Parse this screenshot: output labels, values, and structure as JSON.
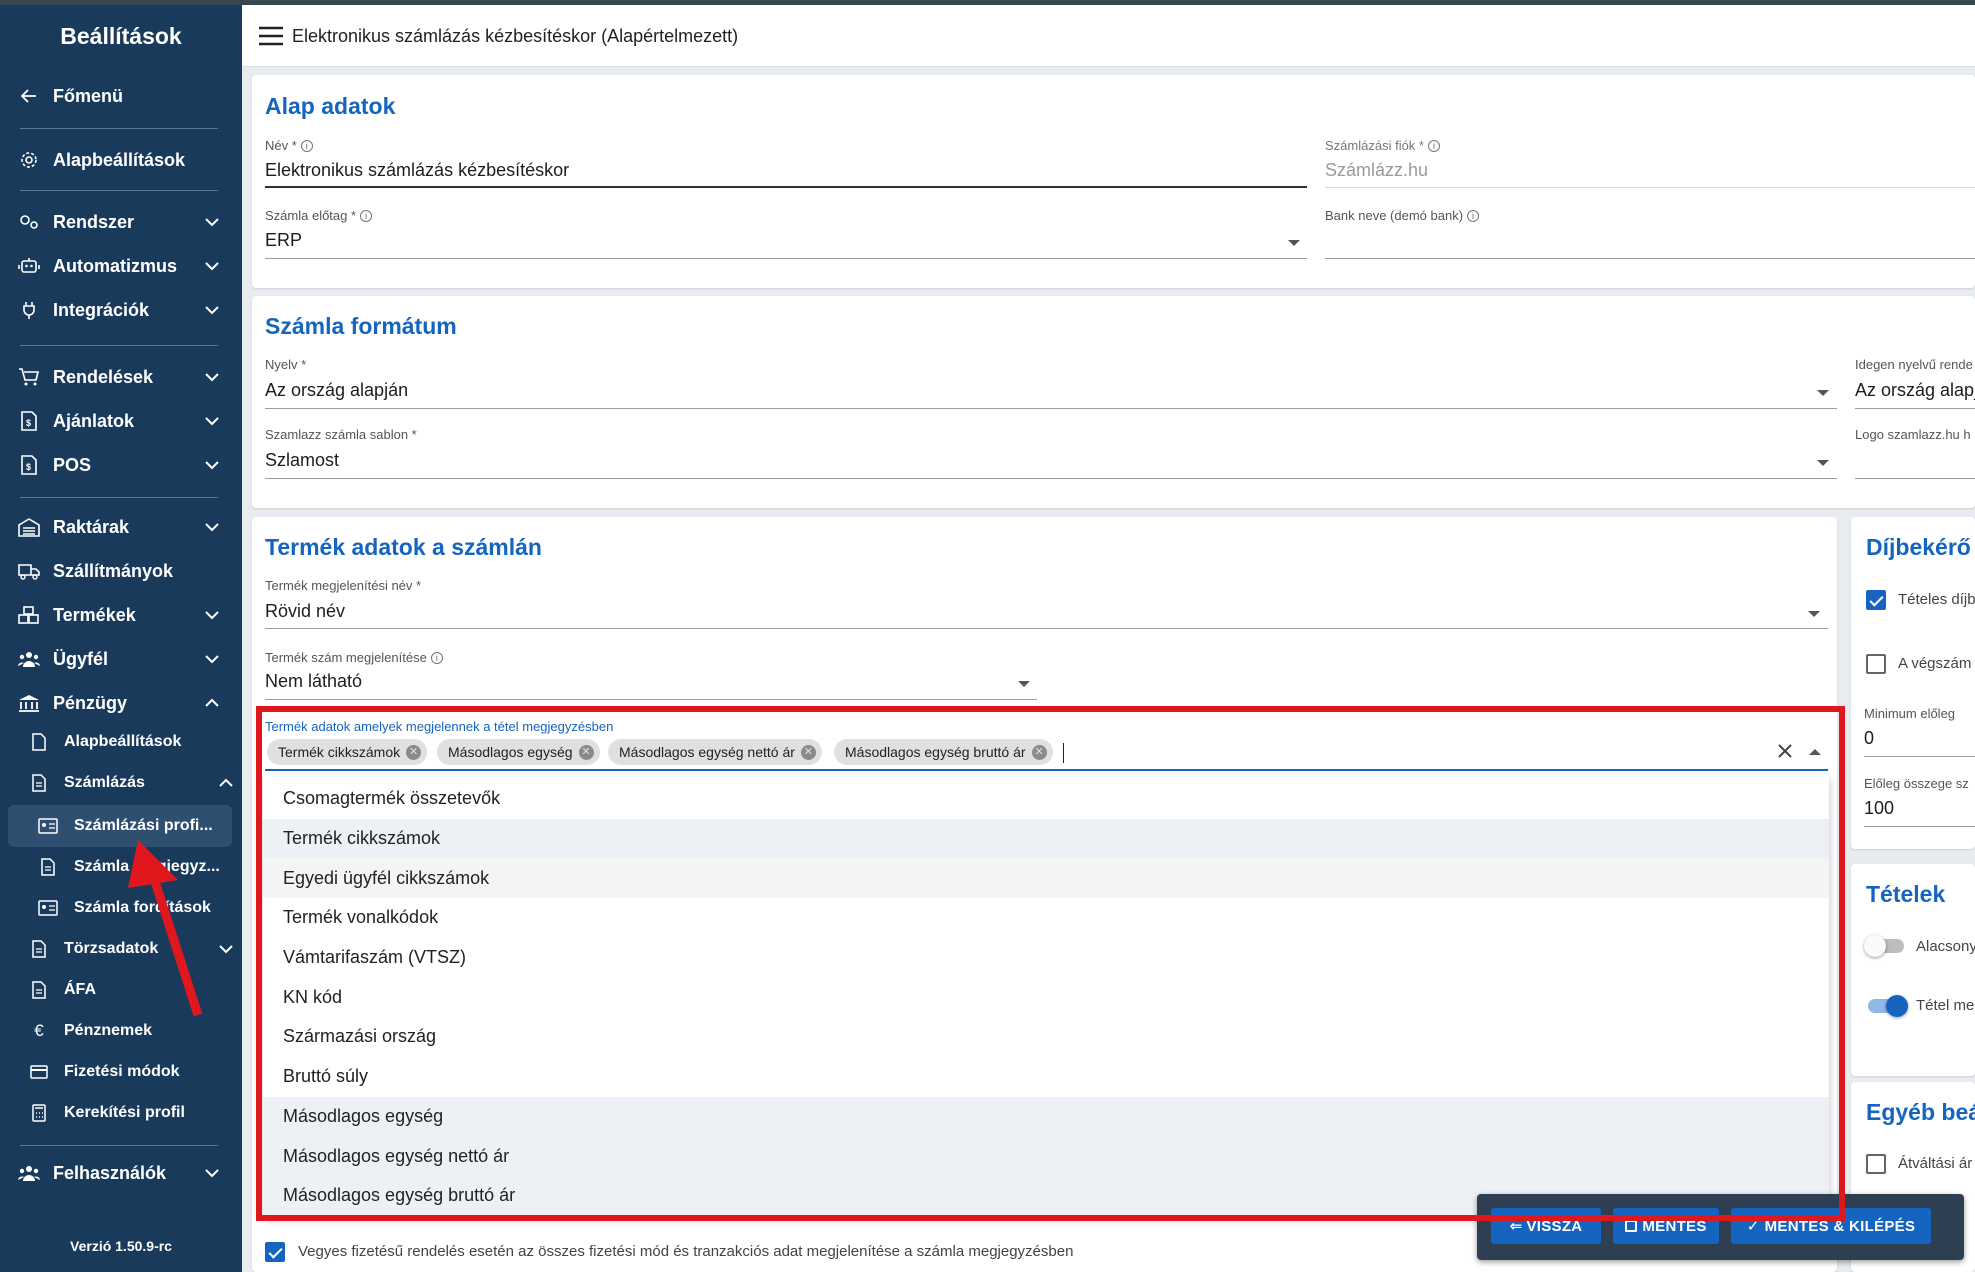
{
  "sidebar": {
    "title": "Beállítások",
    "back_label": "Főmenü",
    "items": {
      "alapbeallitasok": "Alapbeállítások",
      "rendszer": "Rendszer",
      "automatizmus": "Automatizmus",
      "integraciok": "Integrációk",
      "rendelesek": "Rendelések",
      "ajanlatok": "Ajánlatok",
      "pos": "POS",
      "raktarak": "Raktárak",
      "szallitmanyok": "Szállítmányok",
      "termekek": "Termékek",
      "ugyfel": "Ügyfél",
      "penzugy": "Pénzügy",
      "felhasznalok": "Felhasználók"
    },
    "penzugy_sub": {
      "alapbeallitasok": "Alapbeállítások",
      "szamlazas": "Számlázás",
      "torzsadatok": "Törzsadatok",
      "afa": "ÁFA",
      "penznemek": "Pénznemek",
      "fizetesi_modok": "Fizetési módok",
      "kerekitesi_profil": "Kerekítési profil"
    },
    "szamlazas_sub": {
      "profilok": "Számlázási profi...",
      "megjegyzesek": "Számla megjegyz...",
      "forditasok": "Számla fordítások"
    },
    "version": "Verzió 1.50.9-rc"
  },
  "header": {
    "title": "Elektronikus számlázás kézbesítéskor (Alapértelmezett)"
  },
  "alap_adatok": {
    "title": "Alap adatok",
    "nev_label": "Név *",
    "nev_value": "Elektronikus számlázás kézbesítéskor",
    "szamlazasi_fiok_label": "Számlázási fiók *",
    "szamlazasi_fiok_value": "Számlázz.hu",
    "elotag_label": "Számla előtag *",
    "elotag_value": "ERP",
    "bank_label": "Bank neve (demó bank)",
    "bank_value": ""
  },
  "szamla_formatum": {
    "title": "Számla formátum",
    "nyelv_label": "Nyelv *",
    "nyelv_value": "Az ország alapján",
    "idegen_label": "Idegen nyelvű rende",
    "idegen_value": "Az ország alapj",
    "sablon_label": "Szamlazz számla sablon *",
    "sablon_value": "Szlamost",
    "logo_label": "Logo szamlazz.hu h"
  },
  "termek_adatok": {
    "title": "Termék adatok a számlán",
    "megjelenitesi_nev_label": "Termék megjelenítési név *",
    "megjelenitesi_nev_value": "Rövid név",
    "termek_szam_label": "Termék szám megjelenítése",
    "termek_szam_value": "Nem látható",
    "megjegyzes_label": "Termék adatok amelyek megjelennek a tétel megjegyzésben",
    "chips": [
      "Termék cikkszámok",
      "Másodlagos egység",
      "Másodlagos egység nettó ár",
      "Másodlagos egység bruttó ár"
    ],
    "options": [
      "Csomagtermék összetevők",
      "Termék cikkszámok",
      "Egyedi ügyfél cikkszámok",
      "Termék vonalkódok",
      "Vámtarifaszám (VTSZ)",
      "KN kód",
      "Származási ország",
      "Bruttó súly",
      "Másodlagos egység",
      "Másodlagos egység nettó ár",
      "Másodlagos egység bruttó ár"
    ],
    "option_states": [
      "none",
      "selected",
      "hover",
      "none",
      "none",
      "none",
      "none",
      "none",
      "selected",
      "selected",
      "selected"
    ]
  },
  "dijbekero": {
    "title": "Díjbekérő",
    "teteles_label": "Tételes díjb",
    "vegszamla_label": "A végszám",
    "min_eloleg_label": "Minimum előleg",
    "min_eloleg_value": "0",
    "eloleg_osszege_label": "Előleg összege sz",
    "eloleg_osszege_value": "100"
  },
  "tetelek": {
    "title": "Tételek",
    "alacsony_label": "Alacsony",
    "tetel_label": "Tétel me"
  },
  "egyeb": {
    "title": "Egyéb beá",
    "atvaltasi_label": "Átváltási ár"
  },
  "vegyes_fizetes_label": "Vegyes fizetésű rendelés esetén az összes fizetési mód és tranzakciós adat megjelenítése a számla megjegyzésben",
  "actions": {
    "back": "VISSZA",
    "save": "MENTÉS",
    "save_exit": "MENTÉS & KILÉPÉS"
  },
  "colors": {
    "sidebar_bg": "#1a3a5c",
    "accent": "#1565c0",
    "annotation_red": "#e0181e"
  }
}
